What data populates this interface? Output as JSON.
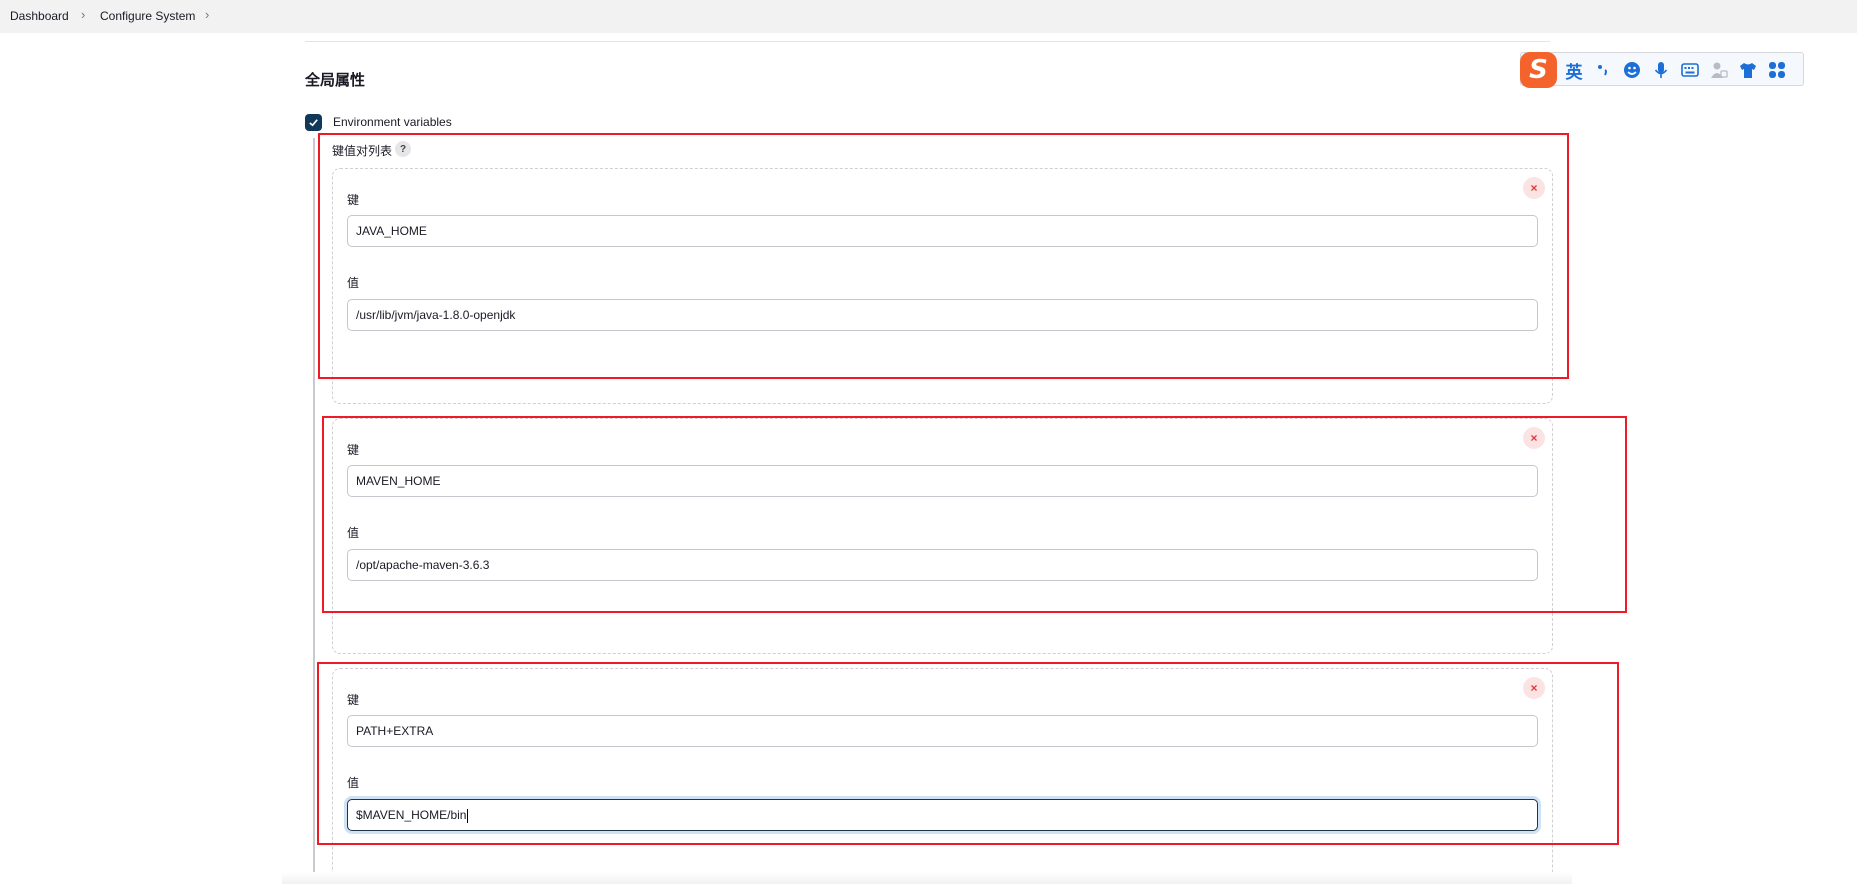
{
  "breadcrumb": [
    {
      "label": "Dashboard"
    },
    {
      "label": "Configure System"
    }
  ],
  "section": {
    "title": "全局属性"
  },
  "env_vars": {
    "checked": true,
    "label": "Environment variables",
    "list_label": "键值对列表",
    "help": "?",
    "key_label": "键",
    "value_label": "值",
    "remove": "×",
    "entries": [
      {
        "key": "JAVA_HOME",
        "value": "/usr/lib/jvm/java-1.8.0-openjdk"
      },
      {
        "key": "MAVEN_HOME",
        "value": "/opt/apache-maven-3.6.3"
      },
      {
        "key": "PATH+EXTRA",
        "value": "$MAVEN_HOME/bin"
      }
    ]
  },
  "ime_toolbar": {
    "logo": "S",
    "lang": "英",
    "icons": [
      "punctuation-icon",
      "emoji-icon",
      "microphone-icon",
      "keyboard-icon",
      "user-icon",
      "skin-icon",
      "toolbox-icon"
    ]
  },
  "colors": {
    "highlight": "#ee1a26",
    "checkbox": "#123859",
    "ime_accent": "#1b6fd6",
    "ime_logo": "#f4632c",
    "remove": "#e0383a"
  }
}
